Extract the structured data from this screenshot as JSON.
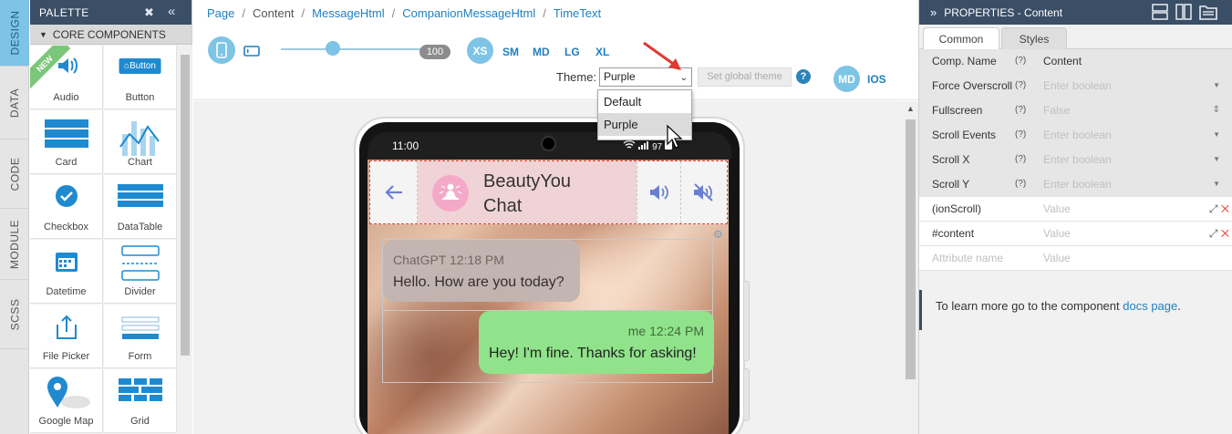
{
  "side_tabs": [
    "DESIGN",
    "DATA",
    "CODE",
    "MODULE",
    "SCSS"
  ],
  "palette": {
    "title": "PALETTE",
    "section": "CORE COMPONENTS",
    "new_badge": "NEW",
    "items": [
      {
        "label": "Audio",
        "icon": "audio-icon"
      },
      {
        "label": "Button",
        "icon": "button-icon",
        "preview": "Button"
      },
      {
        "label": "Card",
        "icon": "card-icon"
      },
      {
        "label": "Chart",
        "icon": "chart-icon"
      },
      {
        "label": "Checkbox",
        "icon": "checkbox-icon"
      },
      {
        "label": "DataTable",
        "icon": "datatable-icon"
      },
      {
        "label": "Datetime",
        "icon": "calendar-icon"
      },
      {
        "label": "Divider",
        "icon": "divider-icon"
      },
      {
        "label": "File Picker",
        "icon": "file-picker-icon"
      },
      {
        "label": "Form",
        "icon": "form-icon"
      },
      {
        "label": "Google Map",
        "icon": "map-pin-icon"
      },
      {
        "label": "Grid",
        "icon": "grid-icon"
      }
    ]
  },
  "breadcrumb": [
    "Page",
    "Content",
    "MessageHtml",
    "CompanionMessageHtml",
    "TimeText"
  ],
  "toolbar": {
    "zoom": "100",
    "zoom_fraction": 0.66,
    "sizes": [
      "XS",
      "SM",
      "MD",
      "LG",
      "XL"
    ],
    "theme_label": "Theme:",
    "theme_value": "Purple",
    "theme_options": [
      "Default",
      "Purple"
    ],
    "set_global": "Set global theme",
    "help": "?",
    "modes": [
      "MD",
      "IOS"
    ]
  },
  "phone": {
    "time": "11:00",
    "battery_text": "97",
    "chat_title": "BeautyYou Chat",
    "messages": [
      {
        "sender": "ChatGPT",
        "time": "12:18 PM",
        "text": "Hello. How are you today?"
      },
      {
        "sender": "me",
        "time": "12:24 PM",
        "text": "Hey! I'm fine. Thanks for asking!"
      }
    ]
  },
  "properties": {
    "title": "PROPERTIES - Content",
    "tabs": [
      "Common",
      "Styles"
    ],
    "q": "(?)",
    "rows": [
      {
        "name": "Comp. Name",
        "value": "Content",
        "placeholder": false,
        "kind": "text"
      },
      {
        "name": "Force Overscroll",
        "value": "Enter boolean",
        "placeholder": true,
        "kind": "dropdown"
      },
      {
        "name": "Fullscreen",
        "value": "False",
        "placeholder": true,
        "kind": "stepper"
      },
      {
        "name": "Scroll Events",
        "value": "Enter boolean",
        "placeholder": true,
        "kind": "dropdown"
      },
      {
        "name": "Scroll X",
        "value": "Enter boolean",
        "placeholder": true,
        "kind": "dropdown"
      },
      {
        "name": "Scroll Y",
        "value": "Enter boolean",
        "placeholder": true,
        "kind": "dropdown"
      },
      {
        "name": "(ionScroll)",
        "value": "Value",
        "placeholder": true,
        "kind": "action"
      },
      {
        "name": "#content",
        "value": "Value",
        "placeholder": true,
        "kind": "action"
      },
      {
        "name": "Attribute name",
        "value": "Value",
        "placeholder": true,
        "kind": "new"
      }
    ],
    "info_text": "To learn more go to the component",
    "info_link": "docs page",
    "info_end": "."
  },
  "colors": {
    "accent": "#7ec4e6",
    "header": "#3a4e66",
    "link": "#1f7fbf",
    "bubble_out": "#90e38a",
    "bubble_in": "#c2b5b2"
  }
}
